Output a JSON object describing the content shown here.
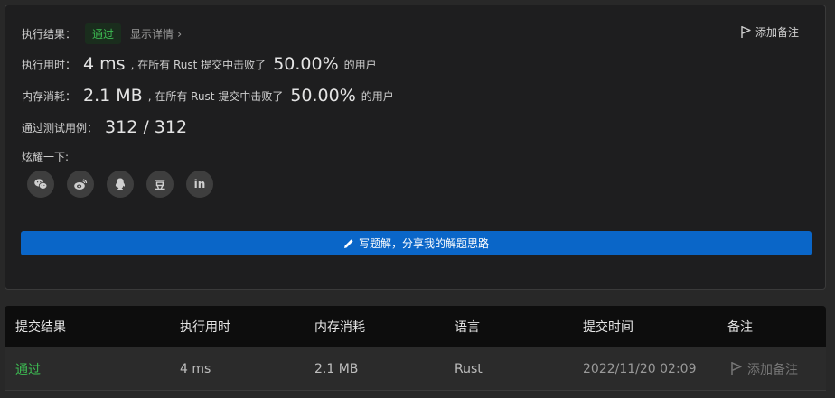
{
  "result": {
    "label": "执行结果：",
    "status": "通过",
    "details_link": "显示详情",
    "details_chevron": "›",
    "add_note": "添加备注"
  },
  "runtime": {
    "label": "执行用时：",
    "value": "4 ms",
    "prefix": ", 在所有 Rust 提交中击败了",
    "percent": "50.00%",
    "suffix": "的用户"
  },
  "memory": {
    "label": "内存消耗：",
    "value": "2.1 MB",
    "prefix": ", 在所有 Rust 提交中击败了",
    "percent": "50.00%",
    "suffix": "的用户"
  },
  "testcases": {
    "label": "通过测试用例：",
    "value": "312 / 312"
  },
  "share": {
    "label": "炫耀一下:",
    "icons": [
      "wechat-icon",
      "weibo-icon",
      "qq-icon",
      "douban-icon",
      "linkedin-icon"
    ],
    "douban_glyph": "豆",
    "linkedin_glyph": "in"
  },
  "write_solution": {
    "label": "写题解，分享我的解题思路",
    "icon": "pencil-icon"
  },
  "submissions_table": {
    "headers": [
      "提交结果",
      "执行用时",
      "内存消耗",
      "语言",
      "提交时间",
      "备注"
    ],
    "rows": [
      [
        "通过",
        "4 ms",
        "2.1 MB",
        "Rust",
        "2022/11/20 02:09",
        "添加备注"
      ]
    ]
  },
  "colors": {
    "accent": "#0a66c8",
    "success": "#3dbd53",
    "panel": "#1e1e1f",
    "background": "#282828"
  }
}
